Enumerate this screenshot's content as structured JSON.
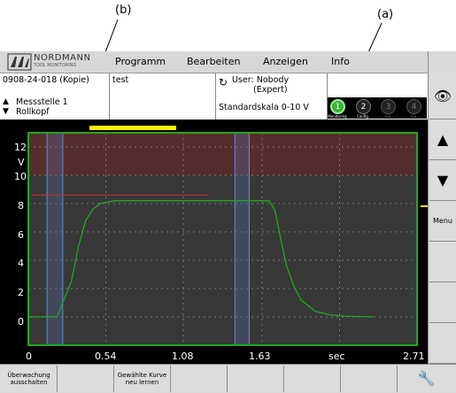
{
  "callouts": {
    "b": "(b)",
    "a": "(a)"
  },
  "brand": {
    "name": "NORDMANN",
    "tagline": "TOOL MONITORING"
  },
  "menu": [
    "Programm",
    "Bearbeiten",
    "Anzeigen",
    "Info"
  ],
  "info": {
    "file": "0908-24-018 (Kopie)",
    "name": "test",
    "user_line1": "User: Nobody",
    "user_line2": "(Expert)",
    "measure_point": "Messstelle  1",
    "location": "Rollkopf",
    "scale": "Standardskala 0-10 V"
  },
  "status_icons": [
    {
      "num": "1",
      "label": "Monitoring",
      "active": true
    },
    {
      "num": "2",
      "label": "Config.",
      "active": false
    },
    {
      "num": "3",
      "label": "n/a",
      "active": false
    },
    {
      "num": "4",
      "label": "n/a",
      "active": false
    }
  ],
  "sidebar": {
    "menu_label": "Menu"
  },
  "bottom_buttons": [
    "Überwachung ausschalten",
    "",
    "Gewählte Kurve neu lernen",
    "",
    "",
    "",
    ""
  ],
  "colors": {
    "frame": "#1fa81f",
    "band": "#5a2c2c",
    "curve": "#1ea81e",
    "marker": "#f2f200"
  },
  "chart_data": {
    "type": "line",
    "y_unit": "V",
    "y_ticks": [
      "12",
      "10",
      "8",
      "6",
      "4",
      "2",
      "0"
    ],
    "x_ticks": [
      "0",
      "0.54",
      "1.08",
      "1.63",
      "sec",
      "2.71"
    ],
    "xlim": [
      0,
      2.71
    ],
    "ylim": [
      -2,
      13
    ],
    "upper_band": [
      10,
      13
    ],
    "threshold": 8.6,
    "series": [
      {
        "x": [
          0.0,
          0.1,
          0.2,
          0.3,
          0.35,
          0.4,
          0.45,
          0.5,
          0.6,
          0.7,
          0.8,
          1.0,
          1.2,
          1.4,
          1.6,
          1.68,
          1.72,
          1.76,
          1.8,
          1.85,
          1.9,
          2.0,
          2.1,
          2.2,
          2.4
        ],
        "y": [
          0.0,
          0.0,
          0.0,
          2.5,
          5.0,
          6.8,
          7.6,
          8.0,
          8.2,
          8.2,
          8.2,
          8.2,
          8.2,
          8.2,
          8.2,
          8.2,
          7.5,
          5.5,
          3.6,
          2.2,
          1.2,
          0.4,
          0.15,
          0.05,
          0.0
        ]
      }
    ]
  }
}
